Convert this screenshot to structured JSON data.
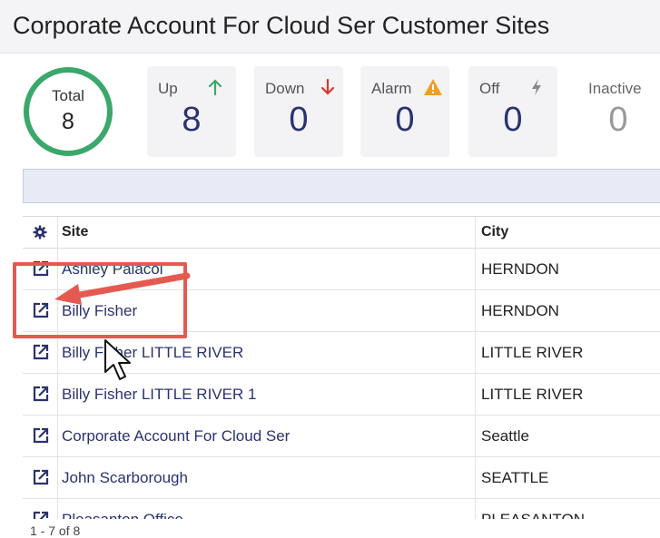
{
  "header": {
    "title": "Corporate Account For Cloud Ser Customer Sites"
  },
  "summary": {
    "total": {
      "label": "Total",
      "value": "8"
    },
    "stats": [
      {
        "label": "Up",
        "value": "8",
        "icon": "arrow-up-icon",
        "icon_color": "#3aa86b"
      },
      {
        "label": "Down",
        "value": "0",
        "icon": "arrow-down-icon",
        "icon_color": "#e0352b"
      },
      {
        "label": "Alarm",
        "value": "0",
        "icon": "warning-icon",
        "icon_color": "#f0a020"
      },
      {
        "label": "Off",
        "value": "0",
        "icon": "bolt-icon",
        "icon_color": "#888888"
      },
      {
        "label": "Inactive",
        "value": "0",
        "icon": "",
        "icon_color": ""
      }
    ]
  },
  "table": {
    "columns": {
      "site": "Site",
      "city": "City"
    },
    "rows": [
      {
        "site": "Ashley Palacol",
        "city": "HERNDON"
      },
      {
        "site": "Billy Fisher",
        "city": "HERNDON"
      },
      {
        "site": "Billy Fisher LITTLE RIVER",
        "city": "LITTLE RIVER"
      },
      {
        "site": "Billy Fisher LITTLE RIVER 1",
        "city": "LITTLE RIVER"
      },
      {
        "site": "Corporate Account For Cloud Ser",
        "city": "Seattle"
      },
      {
        "site": "John Scarborough",
        "city": "SEATTLE"
      },
      {
        "site": "Pleasanton Office",
        "city": "PLEASANTON"
      }
    ]
  },
  "pager": {
    "text": "1 - 7 of 8"
  },
  "colors": {
    "accent": "#2b3270",
    "ring": "#3aa86b",
    "callout": "#e45a50"
  }
}
